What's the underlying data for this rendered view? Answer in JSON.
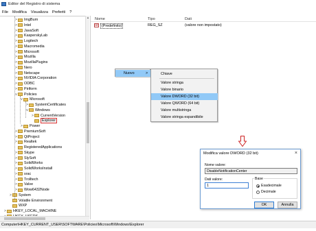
{
  "window": {
    "title": "Editor del Registro di sistema"
  },
  "menu": [
    "File",
    "Modifica",
    "Visualizza",
    "Preferiti",
    "?"
  ],
  "tree": [
    {
      "label": "ImgBurn",
      "indent": 0,
      "exp": ">"
    },
    {
      "label": "Intel",
      "indent": 0,
      "exp": ">"
    },
    {
      "label": "JavaSoft",
      "indent": 0,
      "exp": ">"
    },
    {
      "label": "KasperskyLab",
      "indent": 0,
      "exp": ">"
    },
    {
      "label": "Logitech",
      "indent": 0,
      "exp": ">"
    },
    {
      "label": "Macromedia",
      "indent": 0,
      "exp": ">"
    },
    {
      "label": "Microsoft",
      "indent": 0,
      "exp": ">"
    },
    {
      "label": "Mozilla",
      "indent": 0,
      "exp": ">"
    },
    {
      "label": "MozillaPlugins",
      "indent": 0,
      "exp": ">"
    },
    {
      "label": "Nero",
      "indent": 0,
      "exp": ">"
    },
    {
      "label": "Netscape",
      "indent": 0,
      "exp": ">"
    },
    {
      "label": "NVIDIA Corporation",
      "indent": 0,
      "exp": ">"
    },
    {
      "label": "ODBC",
      "indent": 0,
      "exp": ">"
    },
    {
      "label": "Piriform",
      "indent": 0,
      "exp": ">"
    },
    {
      "label": "Policies",
      "indent": 0,
      "exp": "v"
    },
    {
      "label": "Microsoft",
      "indent": 1,
      "exp": "v"
    },
    {
      "label": "SystemCertificates",
      "indent": 2,
      "exp": ">"
    },
    {
      "label": "Windows",
      "indent": 2,
      "exp": "v"
    },
    {
      "label": "CurrentVersion",
      "indent": 3,
      "exp": ">"
    },
    {
      "label": "Explorer",
      "indent": 3,
      "exp": "",
      "selected": true
    },
    {
      "label": "Power",
      "indent": 1,
      "exp": ">"
    },
    {
      "label": "PremiumSoft",
      "indent": 0,
      "exp": ">"
    },
    {
      "label": "QtProject",
      "indent": 0,
      "exp": ">"
    },
    {
      "label": "Realtek",
      "indent": 0,
      "exp": ">"
    },
    {
      "label": "RegisteredApplications",
      "indent": 0,
      "exp": ""
    },
    {
      "label": "Skype",
      "indent": 0,
      "exp": ">"
    },
    {
      "label": "SlySoft",
      "indent": 0,
      "exp": ">"
    },
    {
      "label": "SolidWorks",
      "indent": 0,
      "exp": ">"
    },
    {
      "label": "SolidWorksInstall",
      "indent": 0,
      "exp": ">"
    },
    {
      "label": "srac",
      "indent": 0,
      "exp": ">"
    },
    {
      "label": "Trolltech",
      "indent": 0,
      "exp": ">"
    },
    {
      "label": "Valve",
      "indent": 0,
      "exp": ">"
    },
    {
      "label": "Wow6432Node",
      "indent": 0,
      "exp": ">"
    },
    {
      "label": "System",
      "indent": -1,
      "exp": ">"
    },
    {
      "label": "Volatile Environment",
      "indent": -1,
      "exp": ""
    },
    {
      "label": "WXP",
      "indent": -1,
      "exp": ""
    },
    {
      "label": "HKEY_LOCAL_MACHINE",
      "indent": -2,
      "exp": ">"
    },
    {
      "label": "HKEY_USERS",
      "indent": -2,
      "exp": ">"
    }
  ],
  "list": {
    "headers": {
      "name": "Nome",
      "type": "Tipo",
      "data": "Dati"
    },
    "rows": [
      {
        "icon": "ab",
        "name": "(Predefinito)",
        "type": "REG_SZ",
        "data": "(valore non impostato)"
      }
    ]
  },
  "context_menu": {
    "nuovo": {
      "label": "Nuovo",
      "arrow": ">"
    },
    "items": [
      "Chiave",
      "Valore stringa",
      "Valore binario",
      "Valore DWORD (32 bit)",
      "Valore QWORD (64 bit)",
      "Valore multistringa",
      "Valore stringa espandibile"
    ]
  },
  "dialog": {
    "title": "Modifica valore DWORD (32 bit)",
    "close": "×",
    "name_label": "Nome valore:",
    "name_value": "DisableNotificationCenter",
    "data_label": "Dati valore:",
    "data_value": "1",
    "base_label": "Base",
    "hex_label": "Esadecimale",
    "dec_label": "Decimale",
    "ok": "OK",
    "cancel": "Annulla"
  },
  "statusbar": {
    "path": "Computer\\HKEY_CURRENT_USER\\SOFTWARE\\Policies\\Microsoft\\Windows\\Explorer"
  },
  "colors": {
    "highlight": "#91c9f7",
    "folder": "#e6c25c",
    "arrow": "#cc2222",
    "selection_border": "#dd3333"
  }
}
